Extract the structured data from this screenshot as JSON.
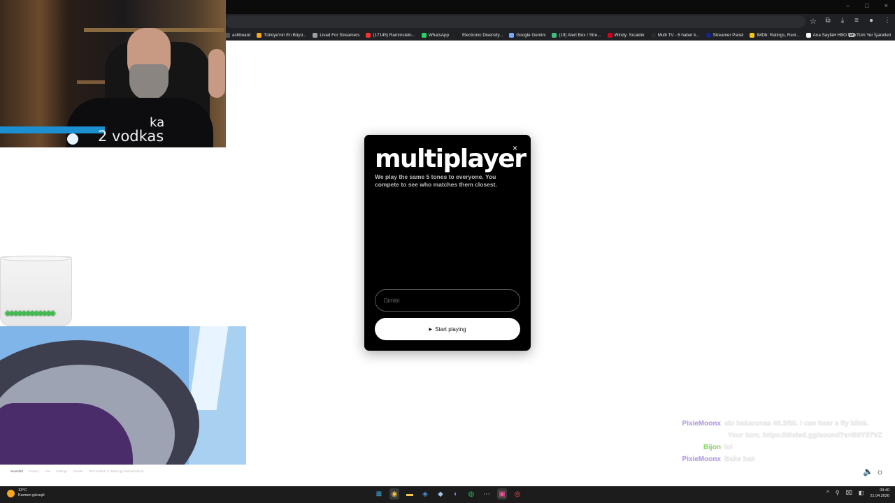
{
  "browser": {
    "window_controls": [
      "–",
      "□",
      "×"
    ],
    "bookmarks": [
      {
        "label": "ashboard",
        "color": "#555555"
      },
      {
        "label": "Türkiye'nin En Büyü...",
        "color": "#f5a623"
      },
      {
        "label": "Livad For Streamers",
        "color": "#9aa0a6"
      },
      {
        "label": "(17145) Rammstein...",
        "color": "#ff3030"
      },
      {
        "label": "WhatsApp",
        "color": "#25d366"
      },
      {
        "label": "Electronic Diversity...",
        "color": "#1f1f1f"
      },
      {
        "label": "Google Gemini",
        "color": "#7aa7ff"
      },
      {
        "label": "(19) Alert Box / Stre...",
        "color": "#3fbf7f"
      },
      {
        "label": "Windy: Sıcaklık",
        "color": "#d0021b"
      },
      {
        "label": "Multi TV - 6 haber k...",
        "color": "#2a2a2a"
      },
      {
        "label": "Streamer Panel",
        "color": "#1a237e"
      },
      {
        "label": "IMDb: Ratings, Revi...",
        "color": "#f5c518"
      },
      {
        "label": "Ana Sayfa • HBO Max",
        "color": "#ffffff"
      }
    ],
    "bookmarks_more": "»",
    "bookmarks_folder": "Tüm Yer İşaretleri"
  },
  "webcam": {
    "shirt_line1": "ka",
    "shirt_line2": "2 vodkas"
  },
  "glass": {
    "clovers": "♣♣♣♣♣♣♣♣♣♣♣♣"
  },
  "modal": {
    "title": "multiplayer",
    "close_icon": "×",
    "description": "We play the same 5 tones to everyone. You compete to see who matches them closest.",
    "name_placeholder": "Dimitri",
    "start_icon": "▶",
    "start_label": "Start playing"
  },
  "footer": {
    "brand": "Sound10",
    "links": [
      "Privacy",
      "Law",
      "Settings",
      "Donate",
      "Get notified on dialed.gg features/drops"
    ]
  },
  "chat": {
    "messages": [
      {
        "user": "PixieMoonx",
        "color": "#b8a0e8",
        "text": "abi bakarsnaa 48.3/50. I can hear a fly blink."
      },
      {
        "user": "",
        "color": "",
        "text": "Your turn. https://dialed.gg/sound?s=B0Y87VZ"
      },
      {
        "user": "Bijon",
        "color": "#88e060",
        "text": "lol"
      },
      {
        "user": "PixieMoonx",
        "color": "#b8a0e8",
        "text": "Bake bak"
      }
    ]
  },
  "page_controls": {
    "volume_icon": "🔈",
    "theme_icon": "☼"
  },
  "taskbar": {
    "weather_temp": "13°C",
    "weather_desc": "Kısmen güneşli",
    "apps": [
      "⊞",
      "◉",
      "▬",
      "◈",
      "◆",
      "◐",
      "◍",
      "⋯",
      "▣",
      "◎"
    ],
    "tray_icons": [
      "^",
      "⚲",
      "⌧",
      "◧",
      "🔊"
    ],
    "clock_time": "09:40",
    "clock_date": "21.04.2026"
  }
}
